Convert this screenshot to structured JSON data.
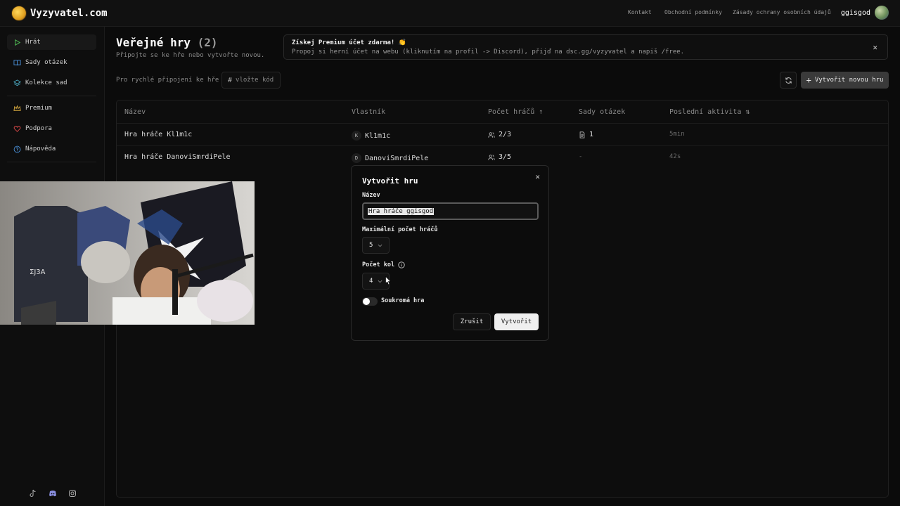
{
  "header": {
    "logo_text": "Vyzyvatel.com",
    "nav": [
      "Kontakt",
      "Obchodní podmínky",
      "Zásady ochrany osobních údajů"
    ],
    "username": "ggisgod"
  },
  "sidebar": {
    "items": [
      {
        "label": "Hrát",
        "icon": "play-icon",
        "active": true
      },
      {
        "label": "Sady otázek",
        "icon": "book-icon"
      },
      {
        "label": "Kolekce sad",
        "icon": "layers-icon"
      },
      {
        "label": "Premium",
        "icon": "crown-icon"
      },
      {
        "label": "Podpora",
        "icon": "heart-icon"
      },
      {
        "label": "Nápověda",
        "icon": "help-icon"
      }
    ],
    "social": [
      "tiktok-icon",
      "discord-icon",
      "instagram-icon"
    ]
  },
  "main": {
    "title": "Veřejné hry",
    "count": "(2)",
    "subtitle": "Připojte se ke hře nebo vytvořte novou.",
    "quick_join_label": "Pro rychlé připojení ke hře",
    "code_placeholder": "vložte kód",
    "create_button": "Vytvořit novou hru"
  },
  "promo": {
    "title": "Získej Premium účet zdarma! 👏",
    "text": "Propoj si herní účet na webu (kliknutím na profil -> Discord), přijď na dsc.gg/vyzyvatel a napiš /free."
  },
  "table": {
    "headers": [
      "Název",
      "Vlastník",
      "Počet hráčů ↑",
      "Sady otázek",
      "Poslední aktivita ⇅"
    ],
    "rows": [
      {
        "name": "Hra hráče Kl1m1c",
        "owner_initial": "K",
        "owner": "Kl1m1c",
        "players": "2/3",
        "sets": "1",
        "activity": "5min"
      },
      {
        "name": "Hra hráče DanoviSmrdiPele",
        "owner_initial": "D",
        "owner": "DanoviSmrdiPele",
        "players": "3/5",
        "sets": "-",
        "activity": "42s"
      }
    ]
  },
  "modal": {
    "title": "Vytvořit hru",
    "name_label": "Název",
    "name_value": "Hra hráče ggisgod",
    "max_players_label": "Maximální počet hráčů",
    "max_players_value": "5",
    "rounds_label": "Počet kol",
    "rounds_value": "4",
    "private_label": "Soukromá hra",
    "private_on": false,
    "cancel_label": "Zrušit",
    "submit_label": "Vytvořit"
  },
  "colors": {
    "background": "#0b0b0b",
    "panel": "#0e0e0e",
    "accent_play": "#4caf50",
    "premium": "#e0b040",
    "support": "#e04a4a",
    "help": "#4a90d9"
  }
}
